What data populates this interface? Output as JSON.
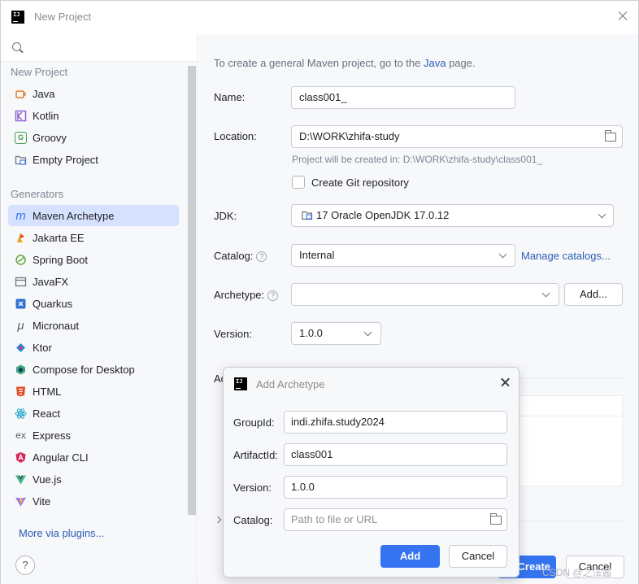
{
  "window": {
    "title": "New Project"
  },
  "sidebar": {
    "search_placeholder": "",
    "new_project_header": "New Project",
    "new_project_items": [
      {
        "label": "Java",
        "icon": "java-cup-icon"
      },
      {
        "label": "Kotlin",
        "icon": "kotlin-icon"
      },
      {
        "label": "Groovy",
        "icon": "groovy-icon"
      },
      {
        "label": "Empty Project",
        "icon": "folder-icon"
      }
    ],
    "generators_header": "Generators",
    "generator_items": [
      {
        "label": "Maven Archetype",
        "icon": "maven-icon",
        "selected": true
      },
      {
        "label": "Jakarta EE",
        "icon": "jakarta-icon"
      },
      {
        "label": "Spring Boot",
        "icon": "spring-icon"
      },
      {
        "label": "JavaFX",
        "icon": "javafx-icon"
      },
      {
        "label": "Quarkus",
        "icon": "quarkus-icon"
      },
      {
        "label": "Micronaut",
        "icon": "micronaut-icon"
      },
      {
        "label": "Ktor",
        "icon": "ktor-icon"
      },
      {
        "label": "Compose for Desktop",
        "icon": "compose-icon"
      },
      {
        "label": "HTML",
        "icon": "html5-icon"
      },
      {
        "label": "React",
        "icon": "react-icon"
      },
      {
        "label": "Express",
        "icon": "express-icon"
      },
      {
        "label": "Angular CLI",
        "icon": "angular-icon"
      },
      {
        "label": "Vue.js",
        "icon": "vue-icon"
      },
      {
        "label": "Vite",
        "icon": "vite-icon"
      }
    ],
    "more_plugins": "More via plugins...",
    "help": "?"
  },
  "main": {
    "intro_before": "To create a general Maven project, go to the ",
    "intro_link": "Java",
    "intro_after": " page.",
    "name_label": "Name:",
    "name_value": "class001_",
    "location_label": "Location:",
    "location_value": "D:\\WORK\\zhifa-study",
    "location_hint": "Project will be created in: D:\\WORK\\zhifa-study\\class001_",
    "git_label": "Create Git repository",
    "git_checked": false,
    "jdk_label": "JDK:",
    "jdk_value": "17 Oracle OpenJDK 17.0.12",
    "catalog_label": "Catalog:",
    "catalog_value": "Internal",
    "manage_catalogs": "Manage catalogs...",
    "archetype_label": "Archetype:",
    "archetype_value": "",
    "add_button": "Add...",
    "version_label": "Version:",
    "version_value": "1.0.0",
    "advanced_label_partial": "Ac",
    "create_button": "Create",
    "cancel_button": "Cancel"
  },
  "dialog": {
    "title": "Add Archetype",
    "groupid_label": "GroupId:",
    "groupid_value": "indi.zhifa.study2024",
    "artifactid_label": "ArtifactId:",
    "artifactid_value": "class001",
    "version_label": "Version:",
    "version_value": "1.0.0",
    "catalog_label": "Catalog:",
    "catalog_placeholder": "Path to file or URL",
    "add_button": "Add",
    "cancel_button": "Cancel"
  },
  "watermark": "CSDN @之法酱",
  "colors": {
    "accent": "#3574f0",
    "selection": "#d5e1ff",
    "link": "#2b5cb8"
  }
}
